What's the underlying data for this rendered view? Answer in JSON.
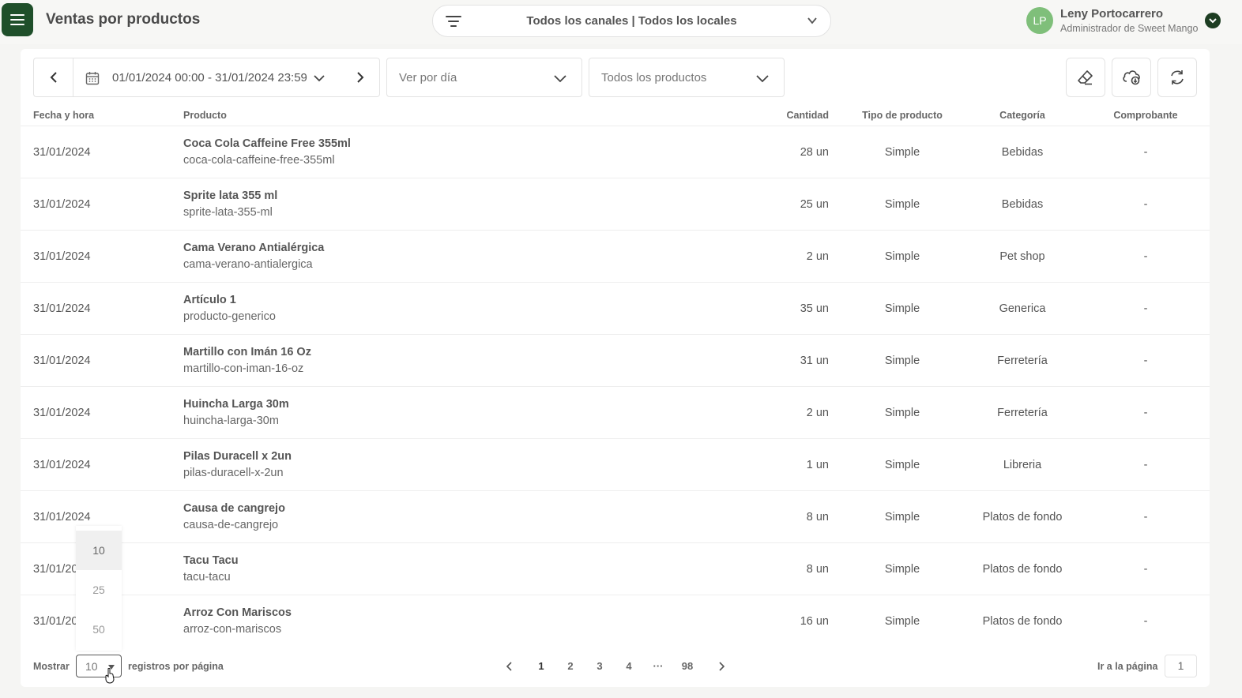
{
  "header": {
    "title": "Ventas por productos",
    "filter_text": "Todos los canales | Todos los locales",
    "user_initials": "LP",
    "user_name": "Leny Portocarrero",
    "user_role": "Administrador de Sweet Mango"
  },
  "toolbar": {
    "date_range": "01/01/2024 00:00 - 31/01/2024 23:59",
    "view_by": "Ver por día",
    "products": "Todos los productos"
  },
  "table": {
    "headers": {
      "date": "Fecha y hora",
      "product": "Producto",
      "qty": "Cantidad",
      "type": "Tipo de producto",
      "category": "Categoría",
      "receipt": "Comprobante"
    },
    "rows": [
      {
        "date": "31/01/2024",
        "name": "Coca Cola Caffeine Free 355ml",
        "slug": "coca-cola-caffeine-free-355ml",
        "qty": "28 un",
        "type": "Simple",
        "category": "Bebidas",
        "receipt": "-"
      },
      {
        "date": "31/01/2024",
        "name": "Sprite lata 355 ml",
        "slug": "sprite-lata-355-ml",
        "qty": "25 un",
        "type": "Simple",
        "category": "Bebidas",
        "receipt": "-"
      },
      {
        "date": "31/01/2024",
        "name": "Cama Verano Antialérgica",
        "slug": "cama-verano-antialergica",
        "qty": "2 un",
        "type": "Simple",
        "category": "Pet shop",
        "receipt": "-"
      },
      {
        "date": "31/01/2024",
        "name": "Artículo 1",
        "slug": "producto-generico",
        "qty": "35 un",
        "type": "Simple",
        "category": "Generica",
        "receipt": "-"
      },
      {
        "date": "31/01/2024",
        "name": "Martillo con Imán 16 Oz",
        "slug": "martillo-con-iman-16-oz",
        "qty": "31 un",
        "type": "Simple",
        "category": "Ferretería",
        "receipt": "-"
      },
      {
        "date": "31/01/2024",
        "name": "Huincha Larga 30m",
        "slug": "huincha-larga-30m",
        "qty": "2 un",
        "type": "Simple",
        "category": "Ferretería",
        "receipt": "-"
      },
      {
        "date": "31/01/2024",
        "name": "Pilas Duracell x 2un",
        "slug": "pilas-duracell-x-2un",
        "qty": "1 un",
        "type": "Simple",
        "category": "Libreria",
        "receipt": "-"
      },
      {
        "date": "31/01/2024",
        "name": "Causa de cangrejo",
        "slug": "causa-de-cangrejo",
        "qty": "8 un",
        "type": "Simple",
        "category": "Platos de fondo",
        "receipt": "-"
      },
      {
        "date": "31/01/2024",
        "name": "Tacu Tacu",
        "slug": "tacu-tacu",
        "qty": "8 un",
        "type": "Simple",
        "category": "Platos de fondo",
        "receipt": "-"
      },
      {
        "date": "31/01/2024",
        "name": "Arroz Con Mariscos",
        "slug": "arroz-con-mariscos",
        "qty": "16 un",
        "type": "Simple",
        "category": "Platos de fondo",
        "receipt": "-"
      }
    ]
  },
  "footer": {
    "show_label": "Mostrar",
    "page_size": "10",
    "page_size_options": [
      "10",
      "25",
      "50"
    ],
    "per_page_label": "registros por página",
    "pages": [
      "1",
      "2",
      "3",
      "4",
      "···",
      "98"
    ],
    "current_page": "1",
    "goto_label": "Ir a la página",
    "goto_value": "1"
  },
  "colors": {
    "brand": "#1f4f2a",
    "avatar": "#7fbf7a"
  },
  "icons": [
    "menu-icon",
    "filter-icon",
    "chevron-down-icon",
    "calendar-icon",
    "chevron-left-icon",
    "chevron-right-icon",
    "eraser-icon",
    "cloud-download-icon",
    "refresh-icon"
  ]
}
